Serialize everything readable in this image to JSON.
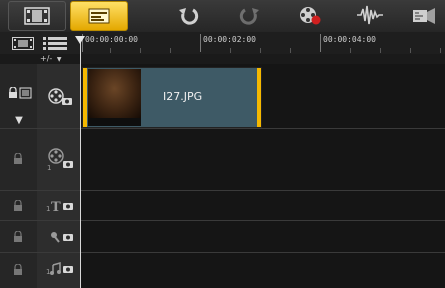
{
  "toolbar": {
    "buttons": [
      {
        "name": "storyboard-view-icon"
      },
      {
        "name": "timeline-view-icon"
      },
      {
        "name": "undo-icon"
      },
      {
        "name": "redo-icon"
      },
      {
        "name": "record-capture-icon"
      },
      {
        "name": "sound-mixer-icon"
      },
      {
        "name": "auto-music-icon"
      }
    ],
    "active_color": "#f5c000"
  },
  "ruler": {
    "labels": [
      "00:00:00:00",
      "00:00:02:00",
      "00:00:04:00"
    ]
  },
  "track_controls": {
    "add_remove_label": "+/-"
  },
  "tracks": [
    {
      "name": "video-track"
    },
    {
      "name": "overlay-track"
    },
    {
      "name": "title-track"
    },
    {
      "name": "voice-track"
    },
    {
      "name": "music-track"
    }
  ],
  "clip": {
    "filename": "I27.JPG",
    "accent_color": "#f5b800",
    "body_color": "#3e5a66"
  }
}
